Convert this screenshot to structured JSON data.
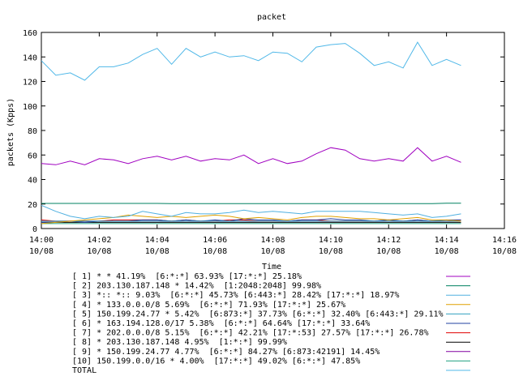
{
  "chart_data": {
    "type": "line",
    "title": "packet",
    "xlabel": "Time",
    "ylabel": "packets (Kpps)",
    "ylim": [
      0,
      160
    ],
    "yticks": [
      0,
      20,
      40,
      60,
      80,
      100,
      120,
      140,
      160
    ],
    "xlim_minutes": [
      0,
      16
    ],
    "xtick_labels": [
      {
        "time": "14:00",
        "date": "10/08"
      },
      {
        "time": "14:02",
        "date": "10/08"
      },
      {
        "time": "14:04",
        "date": "10/08"
      },
      {
        "time": "14:06",
        "date": "10/08"
      },
      {
        "time": "14:08",
        "date": "10/08"
      },
      {
        "time": "14:10",
        "date": "10/08"
      },
      {
        "time": "14:12",
        "date": "10/08"
      },
      {
        "time": "14:14",
        "date": "10/08"
      },
      {
        "time": "14:16",
        "date": "10/08"
      }
    ],
    "x_minutes": [
      0,
      0.5,
      1,
      1.5,
      2,
      2.5,
      3,
      3.5,
      4,
      4.5,
      5,
      5.5,
      6,
      6.5,
      7,
      7.5,
      8,
      8.5,
      9,
      9.5,
      10,
      10.5,
      11,
      11.5,
      12,
      12.5,
      13,
      13.5,
      14,
      14.5
    ],
    "grid": false,
    "legend_position": "bottom",
    "series": [
      {
        "name": "[ 1] * * 41.19%  [6:*:*] 63.93% [17:*:*] 25.18%",
        "color": "#a000c0",
        "values": [
          53,
          52,
          55,
          52,
          57,
          56,
          53,
          57,
          59,
          56,
          59,
          55,
          57,
          56,
          60,
          53,
          57,
          53,
          55,
          61,
          66,
          64,
          57,
          55,
          57,
          55,
          66,
          55,
          59,
          54
        ]
      },
      {
        "name": "[ 2] 203.130.187.148 * 14.42%  [1:2048:2048] 99.98%",
        "color": "#008060",
        "values": [
          20.5,
          20.5,
          20.5,
          20.5,
          20.5,
          20.5,
          20.5,
          20.5,
          20.5,
          20.3,
          20.3,
          20.3,
          20.3,
          20.3,
          20.3,
          20.3,
          20.3,
          20.3,
          20.3,
          20.3,
          20.3,
          20.3,
          20.3,
          20.3,
          20.3,
          20.3,
          20.3,
          20.3,
          20.7,
          20.7
        ]
      },
      {
        "name": "[ 3] *:: *:: 9.03%  [6:*:*] 45.73% [6:443:*] 28.42% [17:*:*] 18.97%",
        "color": "#50b0e0",
        "values": [
          19,
          14,
          10,
          8,
          10,
          9,
          10,
          14,
          12,
          10,
          13,
          12,
          12,
          13,
          15,
          13,
          14,
          13,
          12,
          14,
          14,
          14,
          14,
          13,
          12,
          11,
          12,
          9,
          10,
          12
        ]
      },
      {
        "name": "[ 4] * 133.0.0.0/8 5.69%  [6:*:*] 71.93% [17:*:*] 25.67%",
        "color": "#e0a000",
        "values": [
          4,
          5,
          6,
          7,
          8,
          9,
          11,
          10,
          9,
          10,
          9,
          10,
          11,
          10,
          8,
          9,
          8,
          7,
          9,
          10,
          10,
          9,
          8,
          8,
          7,
          8,
          9,
          7,
          7,
          6
        ]
      },
      {
        "name": "[ 5] 150.199.24.77 * 5.42%  [6:873:*] 37.73% [6:*:*] 32.40% [6:443:*] 29.11%",
        "color": "#30a0c0",
        "values": [
          6,
          6,
          6,
          6,
          6,
          6,
          6,
          6,
          6,
          6,
          6,
          6,
          6,
          6,
          6,
          6,
          6,
          6,
          6,
          6,
          6,
          6,
          6,
          6,
          6,
          6,
          6,
          6,
          6,
          6
        ]
      },
      {
        "name": "[ 6] * 163.194.128.0/17 5.38%  [6:*:*] 64.64% [17:*:*] 33.64%",
        "color": "#2040a0",
        "values": [
          5,
          5,
          6,
          5,
          6,
          6,
          6,
          7,
          7,
          6,
          7,
          6,
          7,
          6,
          8,
          7,
          7,
          6,
          7,
          7,
          8,
          7,
          7,
          6,
          7,
          6,
          7,
          6,
          7,
          7
        ]
      },
      {
        "name": "[ 7] * 202.0.0.0/8 5.15%  [6:*:*] 42.21% [17:*:53] 27.57% [17:*:*] 26.78%",
        "color": "#e00000",
        "values": [
          7,
          6,
          6,
          6,
          6,
          7,
          7,
          7,
          7,
          6,
          7,
          6,
          6,
          7,
          7,
          6,
          6,
          6,
          7,
          7,
          6,
          6,
          6,
          6,
          7,
          6,
          7,
          6,
          6,
          7
        ]
      },
      {
        "name": "[ 8] * 203.130.187.148 4.95%  [1:*:*] 99.99%",
        "color": "#000000",
        "values": [
          5,
          5,
          5,
          5,
          5,
          5,
          5,
          5,
          5,
          5,
          5,
          5,
          5,
          5,
          5,
          5,
          5,
          5,
          5,
          5,
          5,
          5,
          5,
          5,
          5,
          5,
          5,
          5,
          5,
          5
        ]
      },
      {
        "name": "[ 9] * 150.199.24.77 4.77%  [6:*:*] 84.27% [6:873:42191] 14.45%",
        "color": "#8000a0",
        "values": [
          6,
          6,
          6,
          6,
          6,
          6,
          6,
          6,
          6,
          6,
          6,
          6,
          6,
          6,
          6,
          6,
          6,
          6,
          6,
          6,
          6,
          6,
          6,
          6,
          6,
          6,
          6,
          6,
          6,
          6
        ]
      },
      {
        "name": "[10] 150.199.0.0/16 * 4.00%  [17:*:*] 49.02% [6:*:*] 47.85%",
        "color": "#20a080",
        "values": [
          4,
          4,
          4,
          4,
          4,
          4,
          4,
          4,
          4,
          4,
          4,
          4,
          4,
          4,
          4,
          4,
          4,
          4,
          4,
          4,
          4,
          4,
          4,
          4,
          4,
          4,
          4,
          4,
          4,
          4
        ]
      },
      {
        "name": "TOTAL",
        "color": "#50b8e8",
        "values": [
          137,
          125,
          127,
          121,
          132,
          132,
          135,
          142,
          147,
          134,
          147,
          140,
          144,
          140,
          141,
          137,
          144,
          143,
          136,
          148,
          150,
          151,
          143,
          133,
          136,
          131,
          152,
          133,
          138,
          133
        ]
      }
    ]
  }
}
